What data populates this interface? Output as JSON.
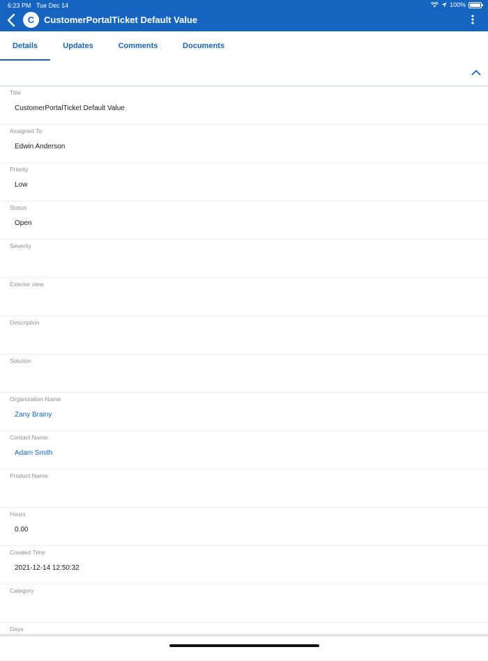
{
  "status_bar": {
    "time": "6:23 PM",
    "date": "Tue Dec 14",
    "battery": "100%",
    "icons": [
      "wifi-icon",
      "location-icon",
      "battery-icon"
    ]
  },
  "app_bar": {
    "avatar_letter": "C",
    "title": "CustomerPortalTicket Default Value",
    "icons": [
      "back-icon",
      "more-vertical-icon"
    ]
  },
  "tabs": [
    {
      "label": "Details",
      "active": true
    },
    {
      "label": "Updates",
      "active": false
    },
    {
      "label": "Comments",
      "active": false
    },
    {
      "label": "Documents",
      "active": false
    }
  ],
  "collapse_icon": "chevron-up-icon",
  "fields": [
    {
      "label": "Title",
      "value": "CustomerPortalTicket Default Value"
    },
    {
      "label": "Assigned To",
      "value": "Edwin Anderson"
    },
    {
      "label": "Priority",
      "value": "Low"
    },
    {
      "label": "Status",
      "value": "Open"
    },
    {
      "label": "Severity",
      "value": ""
    },
    {
      "label": "Exterior view",
      "value": ""
    },
    {
      "label": "Description",
      "value": ""
    },
    {
      "label": "Solution",
      "value": ""
    },
    {
      "label": "Organization Name",
      "value": "Zany Brainy",
      "link": true
    },
    {
      "label": "Contact Name",
      "value": "Adam Smith",
      "link": true
    },
    {
      "label": "Product Name",
      "value": ""
    },
    {
      "label": "Hours",
      "value": "0.00"
    },
    {
      "label": "Created Time",
      "value": "2021-12-14 12:50:32"
    },
    {
      "label": "Category",
      "value": ""
    },
    {
      "label": "Days",
      "value": ""
    }
  ],
  "colors": {
    "primary": "#1565c0",
    "label": "#8e8e8e",
    "divider": "#ececec"
  }
}
